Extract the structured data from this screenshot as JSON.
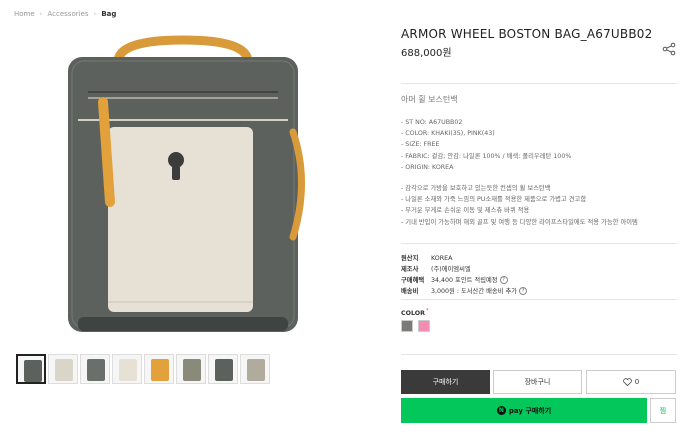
{
  "breadcrumb": [
    "Home",
    "Accessories",
    "Bag"
  ],
  "product": {
    "title": "ARMOR WHEEL BOSTON BAG_A67UBB02",
    "price": "688,000원",
    "subname": "아머 휠 보스턴백",
    "specs": [
      "- ST NO: A67UBB02",
      "- COLOR: KHAKI(35), PINK(43)",
      "- SIZE: FREE",
      "- FABRIC: 겉감; 안감: 나일론 100% / 배색: 폴리우레탄 100%",
      "- ORIGIN: KOREA"
    ],
    "description": [
      "- 감각으로 가방을 보호하고 있는듯한 컨셉의 휠 보스턴백",
      "- 나일론 소재와 가죽 느낌의 PU소재를 적용한 제품으로 가볍고 견고함",
      "- 무거운 무게로 손쉬운 이동 및 제스츄 바퀴 적용",
      "- 기내 반입이 가능하며 해외 골프 및 여행 등 다양한 라이프스타일에도 적용 가능한 아이템"
    ]
  },
  "info": {
    "origin_label": "원산지",
    "origin_value": "KOREA",
    "maker_label": "제조사",
    "maker_value": "(주)에이엠씨엘",
    "benefit_label": "구매혜택",
    "benefit_value": "34,400 포인트 적립예정",
    "shipping_label": "배송비",
    "shipping_value": "3,000원 : 도서산간 배송비 추가"
  },
  "color": {
    "label": "COLOR",
    "required_mark": "*",
    "swatches": [
      {
        "name": "KHAKI",
        "hex": "#7a7a78"
      },
      {
        "name": "PINK",
        "hex": "#f28cb0"
      }
    ]
  },
  "buttons": {
    "buy": "구매하기",
    "cart": "장바구니",
    "wish_count": "0",
    "npay": "pay 구매하기",
    "npay_n": "N",
    "npay_wish": "찜"
  },
  "qmark": "?",
  "icons": [
    "share-icon",
    "heart-icon",
    "naver-pay-icon"
  ],
  "colors": {
    "dark_button": "#3a3a3a",
    "npay_green": "#03c75a",
    "bag_khaki": "#5e6360",
    "bag_cream": "#e8e4d8",
    "strap_orange": "#e2a13a"
  }
}
